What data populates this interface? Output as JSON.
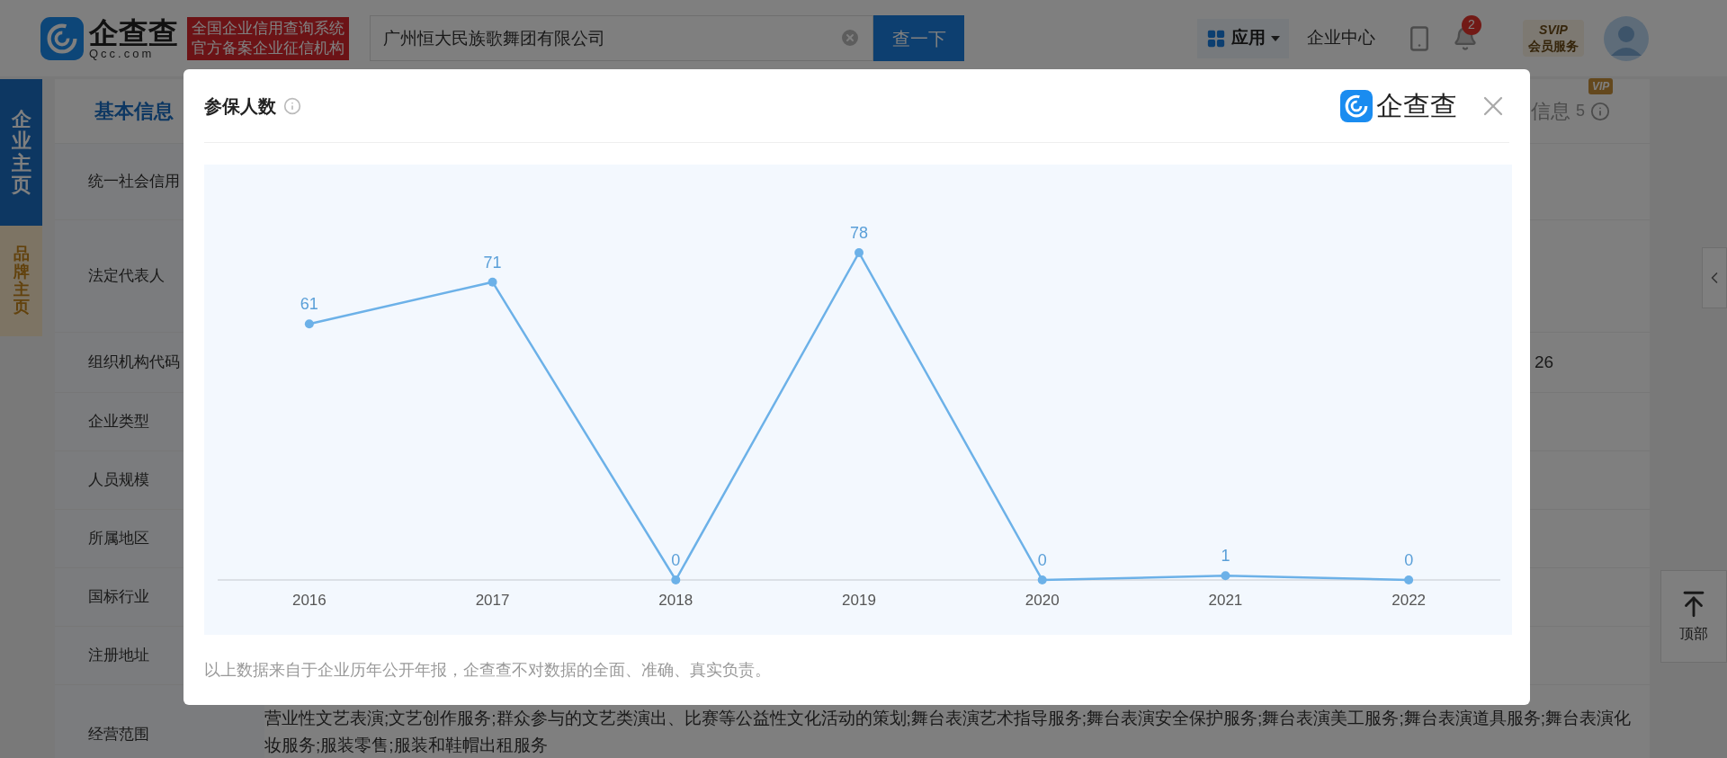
{
  "header": {
    "logo_text": "企查查",
    "logo_domain": "Qcc.com",
    "badge_lines": [
      "全国企业信用查询系统",
      "官方备案企业征信机构"
    ],
    "search": {
      "value": "广州恒大民族歌舞团有限公司"
    },
    "search_button": "查一下",
    "apps": "应用",
    "enterprise_center": "企业中心",
    "notification_count": "2",
    "svip": "SVIP",
    "member_service": "会员服务"
  },
  "side_tabs": [
    {
      "label": "企业主页",
      "selected": true
    },
    {
      "label": "品牌主页",
      "selected": false
    }
  ],
  "section_tabs": [
    {
      "label": "基本信息",
      "selected": true
    },
    {
      "label": "信息",
      "count": "5",
      "vip": "VIP",
      "selected": false
    }
  ],
  "info_rows": [
    {
      "label": "统一社会信用"
    },
    {
      "label": "法定代表人"
    },
    {
      "label": "组织机构代码",
      "value": "26",
      "kind": "tail"
    },
    {
      "label": "企业类型"
    },
    {
      "label": "人员规模"
    },
    {
      "label": "所属地区"
    },
    {
      "label": "国标行业"
    },
    {
      "label": "注册地址"
    },
    {
      "label": "经营范围",
      "value": "营业性文艺表演;文艺创作服务;群众参与的文艺类演出、比赛等公益性文化活动的策划;舞台表演艺术指导服务;舞台表演安全保护服务;舞台表演美工服务;舞台表演道具服务;舞台表演化妆服务;服装零售;服装和鞋帽出租服务",
      "kind": "text"
    }
  ],
  "back_to_top": "顶部",
  "modal": {
    "title": "参保人数",
    "logo_text": "企查查",
    "chart_data": {
      "type": "line",
      "categories": [
        "2016",
        "2017",
        "2018",
        "2019",
        "2020",
        "2021",
        "2022"
      ],
      "series": [
        {
          "color": "#6cb1e8",
          "marker": true,
          "values": [
            61,
            71,
            0,
            78,
            0,
            1,
            0
          ]
        }
      ],
      "data_labels": true
    },
    "footnote": "以上数据来自于企业历年公开年报，企查查不对数据的全面、准确、真实负责。"
  }
}
